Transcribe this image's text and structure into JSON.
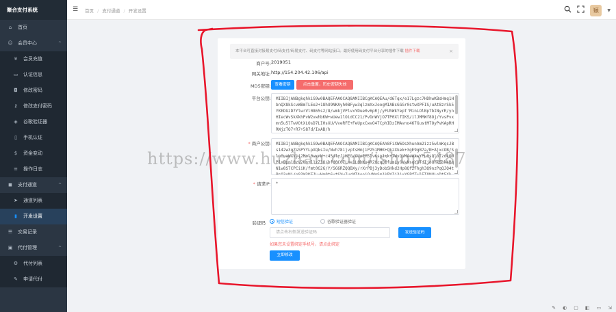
{
  "sidebar": {
    "brand": "聚合支付系统",
    "items": [
      {
        "label": "首页",
        "icon": "home-icon",
        "type": "top"
      },
      {
        "label": "会员中心",
        "icon": "user-icon",
        "type": "group",
        "caret": "^"
      },
      {
        "label": "会员充值",
        "icon": "yen-icon",
        "type": "sub"
      },
      {
        "label": "认证信息",
        "icon": "card-icon",
        "type": "sub"
      },
      {
        "label": "修改密码",
        "icon": "lock-icon",
        "type": "sub"
      },
      {
        "label": "修改支付密码",
        "icon": "key-icon",
        "type": "sub"
      },
      {
        "label": "谷歌验证器",
        "icon": "shield-icon",
        "type": "sub"
      },
      {
        "label": "手机认证",
        "icon": "phone-icon",
        "type": "sub"
      },
      {
        "label": "资金变动",
        "icon": "money-icon",
        "type": "sub"
      },
      {
        "label": "操作日志",
        "icon": "log-icon",
        "type": "sub"
      },
      {
        "label": "支付通道",
        "icon": "channel-icon",
        "type": "group",
        "caret": "^"
      },
      {
        "label": "通道列表",
        "icon": "send-icon",
        "type": "sub"
      },
      {
        "label": "开发设置",
        "icon": "dev-icon",
        "type": "sub",
        "active": true
      },
      {
        "label": "交易记录",
        "icon": "list-icon",
        "type": "top"
      },
      {
        "label": "代付管理",
        "icon": "wallet-icon",
        "type": "group",
        "caret": "^"
      },
      {
        "label": "代付列表",
        "icon": "gear-icon",
        "type": "sub"
      },
      {
        "label": "申请代付",
        "icon": "edit-icon",
        "type": "sub"
      }
    ]
  },
  "header": {
    "breadcrumb": [
      "首页",
      "/",
      "支付通道",
      "/",
      "开发设置"
    ],
    "avatar_text": "颖"
  },
  "notice": {
    "text": "本平台可直接对接易支付/码支付/码易支付、码支付等网站接口。最好使用码支付平台分享的插件下载",
    "link": "插件下载",
    "close": "×"
  },
  "form": {
    "merchant_label": "商户号:",
    "merchant_value": "2019051",
    "gateway_label": "网关地址:",
    "gateway_value": "http://154.204.42.106/api",
    "md5_label": "MD5密钥:",
    "md5_view_btn": "查看密钥",
    "md5_reset_btn": "点击重置，历史密钥失效",
    "platform_key_label": "平台公钥:",
    "platform_key_value": "MIIBIjANBgkqhkiG9w0BAQEFAAOCAQ8AMIIBCgKCAQEAu/d6Tqx/e17Lgzc7HDhwKBsHmq1HbnQX8kScvWBmTLEe2+18hU9NKAyh0BFyw3qlzmXxJoogMIABsGGGr0stwXPFIS/uAt8zrSk5YKEDGzD7YlwrVl0865s2/8/wmkjVPlvxYDue0v6pRj/yFUhWkYepT'MinLOlBpTbINyrR/ynHIecWvSkXkhPvW2vwhbKW+wUew1lOidCC21/PvDnWVjO7TP0XlfIKS/ilJMMWf8Oj/YvsPvxmn5u5lTwVOtXLOsD7LI0sXU/VveRFE+FeUpxCwvO47CphIDzIMAvno467GustM7OyPvKApRHRWjzTO7+R7+587d/IxAB/h",
    "merchant_key_label": "商户公钥:",
    "merchant_key_value": "MIIBIjANBgkqhkiG9w0BAQEFAAOCAQ8AMIIBCgKCAQEAh8FiXW6OsXhunAm2izz5wlmKqsJBs142w3gZsSPYYLpXQksIu/Nvh78ijvptsHmjiP251MHK+QkzXkek+3gE9gB7a/N+AjxcOB/Sln0uaWXVjj2Mol0wxrW+c45dl+JjHEG/GUoPM5lvKsp1+k+TWvQVMAeWkwYPu0sQloTzdkOUPlxBpn10zV2Un+l1zZ3Q/bfd0C67Lne1L0hKu4R2VcqDtfumLyGVwNsqYOTdIjoQhkSbk4BqN1w8S7CPCiiK/fmt0G2G/Y/SG6RZQQBXy/rXrPBj3yDobSHkd2Hp8Qf2Fhgh3Q9nzPqQJQ4tPsO3oNj/p83W3KFJLwHm0t6vtSYw7usMTAoeiQ/MgSm1kPYIj3jxXSPfTwlET8NULoDt5Xk",
    "callback_ip_label": "请求IP:",
    "callback_ip_value": "*",
    "verify_label": "验证码",
    "verify_options": [
      "短信验证",
      "谷歌验证器验证"
    ],
    "code_placeholder": "请点击右侧发送验证码",
    "send_code_btn": "发送验证码",
    "hint": "如果您未设置绑定手机号，请点此绑定",
    "submit_btn": "立即修改"
  },
  "watermark": "https://www.huzhan.com/ishop5487",
  "annotation": {
    "color": "#e8162b"
  }
}
